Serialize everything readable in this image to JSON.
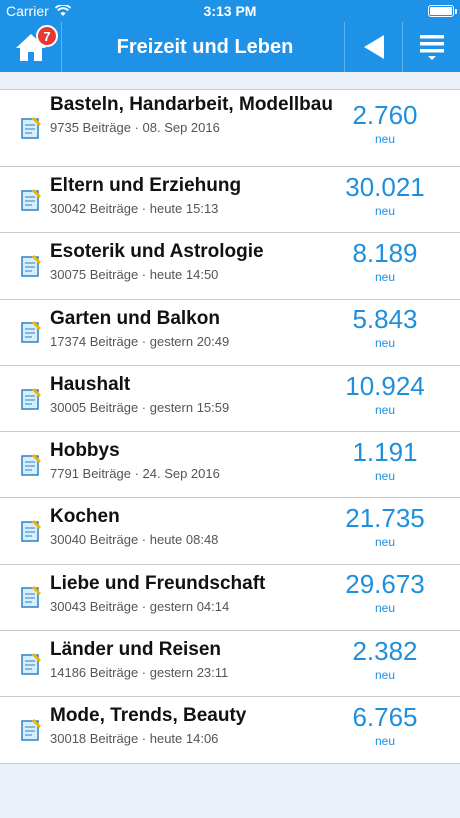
{
  "status": {
    "carrier": "Carrier",
    "time": "3:13 PM"
  },
  "nav": {
    "title": "Freizeit und Leben",
    "badge": "7"
  },
  "colors": {
    "accent": "#1e92e6",
    "count": "#1e8fdc",
    "badge": "#e53935"
  },
  "forums": [
    {
      "title": "Basteln, Handarbeit, Modellbau",
      "meta": "9735 Beiträge · 08. Sep 2016",
      "count": "2.760",
      "label": "neu"
    },
    {
      "title": "Eltern und Erziehung",
      "meta": "30042 Beiträge · heute 15:13",
      "count": "30.021",
      "label": "neu"
    },
    {
      "title": "Esoterik und Astrologie",
      "meta": "30075 Beiträge · heute 14:50",
      "count": "8.189",
      "label": "neu"
    },
    {
      "title": "Garten und Balkon",
      "meta": "17374 Beiträge · gestern 20:49",
      "count": "5.843",
      "label": "neu"
    },
    {
      "title": "Haushalt",
      "meta": "30005 Beiträge · gestern 15:59",
      "count": "10.924",
      "label": "neu"
    },
    {
      "title": "Hobbys",
      "meta": "7791 Beiträge · 24. Sep 2016",
      "count": "1.191",
      "label": "neu"
    },
    {
      "title": "Kochen",
      "meta": "30040 Beiträge · heute 08:48",
      "count": "21.735",
      "label": "neu"
    },
    {
      "title": "Liebe und Freundschaft",
      "meta": "30043 Beiträge · gestern 04:14",
      "count": "29.673",
      "label": "neu"
    },
    {
      "title": "Länder und Reisen",
      "meta": "14186 Beiträge · gestern 23:11",
      "count": "2.382",
      "label": "neu"
    },
    {
      "title": "Mode, Trends, Beauty",
      "meta": "30018 Beiträge · heute 14:06",
      "count": "6.765",
      "label": "neu"
    }
  ]
}
